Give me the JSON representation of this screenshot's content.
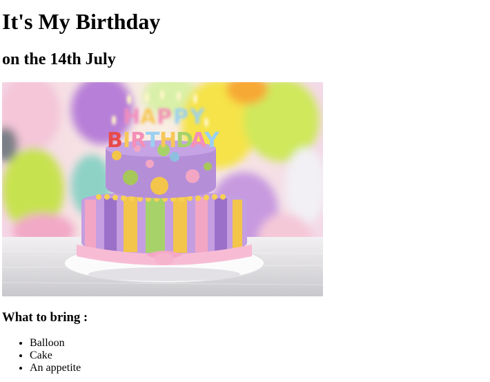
{
  "page": {
    "title": "It's My Birthday",
    "subtitle": "on the 14th July"
  },
  "image": {
    "description_icon": "birthday-cake-photo",
    "cake_text_top": "HAPPY",
    "cake_text_bottom": "BIRTHDAY"
  },
  "bring": {
    "heading": "What to bring :",
    "items": [
      "Balloon",
      "Cake",
      "An appetite"
    ]
  }
}
